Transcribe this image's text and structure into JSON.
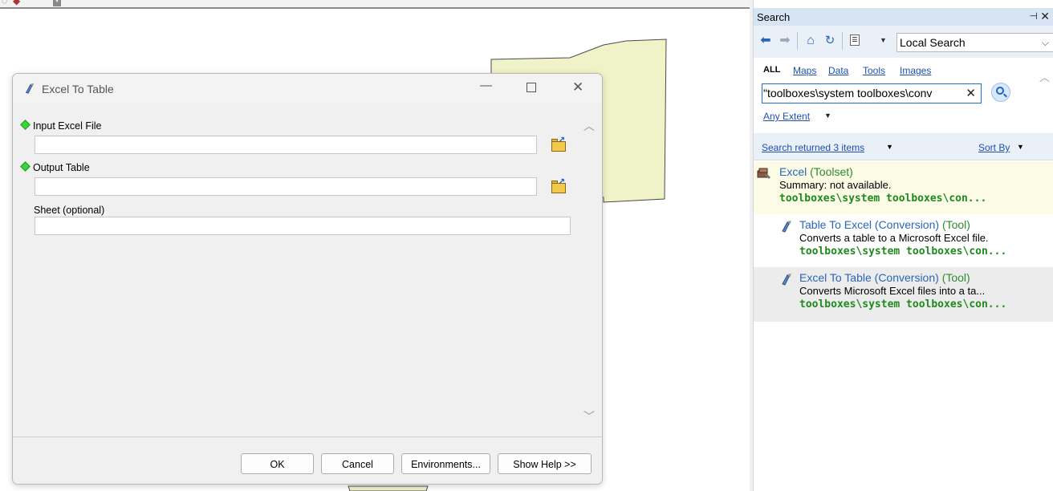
{
  "map": {
    "toolbar_icons": [
      "pointer-icon",
      "identify-icon",
      "dropdown-icon"
    ]
  },
  "search_pane": {
    "title": "Search",
    "pin_glyph": "⊣",
    "close_glyph": "✕",
    "scope": "Local Search",
    "filters": {
      "all": "ALL",
      "maps": "Maps",
      "data": "Data",
      "tools": "Tools",
      "images": "Images"
    },
    "query": "\"toolboxes\\system toolboxes\\conv",
    "extent": "Any Extent",
    "results_count": "Search returned 3 items",
    "sort_by": "Sort By",
    "results": [
      {
        "title": "Excel",
        "type": "(Toolset)",
        "summary": "Summary: not available.",
        "path": "toolboxes\\system toolboxes\\con...",
        "icon": "toolset-icon"
      },
      {
        "title": "Table To Excel (Conversion)",
        "type": "(Tool)",
        "summary": "Converts a table to a Microsoft Excel file.",
        "path": "toolboxes\\system toolboxes\\con...",
        "icon": "tool-icon"
      },
      {
        "title": "Excel To Table (Conversion)",
        "type": "(Tool)",
        "summary": "Converts Microsoft Excel files into a ta...",
        "path": "toolboxes\\system toolboxes\\con...",
        "icon": "tool-icon"
      }
    ]
  },
  "dialog": {
    "title": "Excel To Table",
    "params": {
      "input_excel": {
        "label": "Input Excel File",
        "value": ""
      },
      "output_table": {
        "label": "Output Table",
        "value": ""
      },
      "sheet": {
        "label": "Sheet (optional)",
        "value": ""
      }
    },
    "buttons": {
      "ok": "OK",
      "cancel": "Cancel",
      "environments": "Environments...",
      "show_help": "Show Help >>"
    }
  },
  "colors": {
    "map_feature_fill": "#f0f2c8",
    "map_feature_stroke": "#4a4a4a",
    "link_blue": "#1f4fb0",
    "path_green": "#1e8a1e",
    "pane_header": "#d6e4f3",
    "selected_result": "#fbfbe6"
  }
}
